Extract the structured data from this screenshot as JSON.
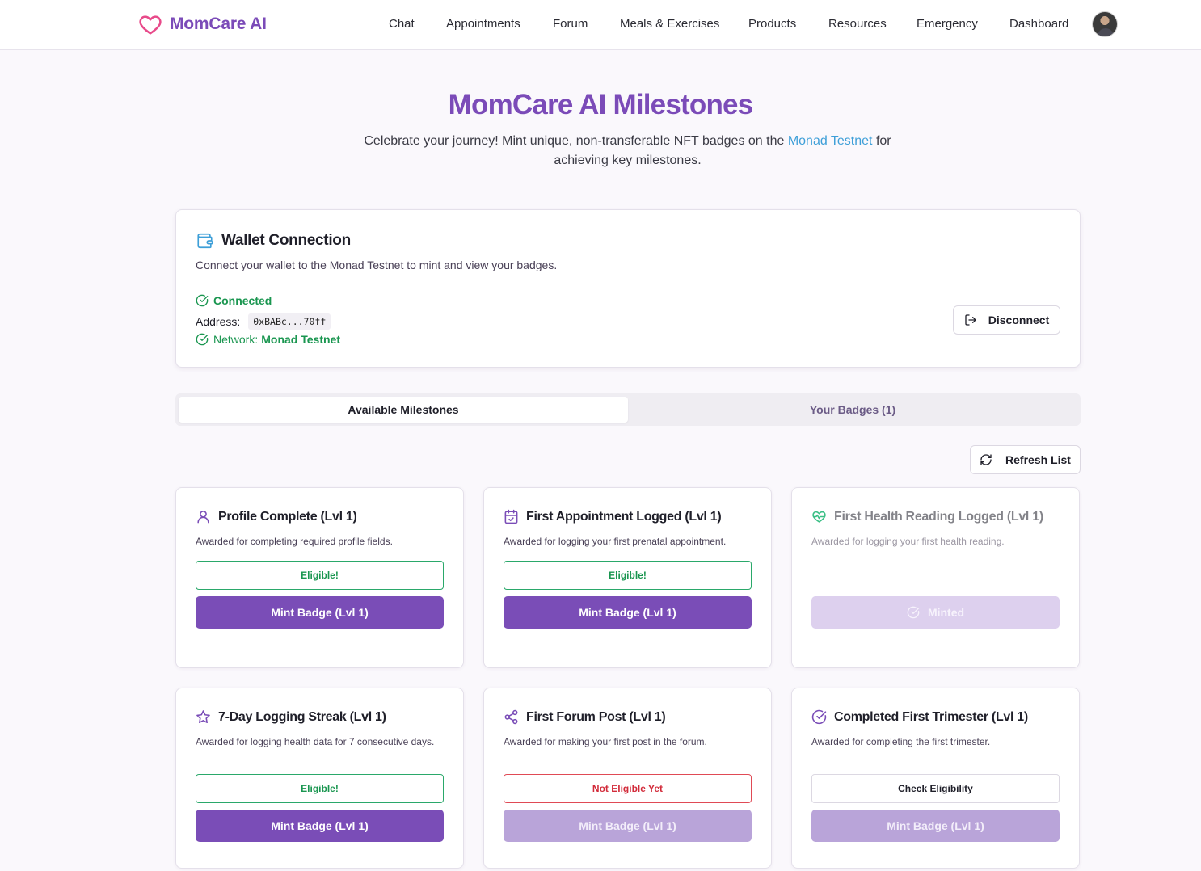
{
  "brand": {
    "name": "MomCare AI",
    "icon": "heart-icon",
    "color": "#7b4bb8",
    "accent": "#e84a8a"
  },
  "nav": {
    "items": [
      {
        "key": "chat",
        "label": "Chat"
      },
      {
        "key": "appointments",
        "label": "Appointments"
      },
      {
        "key": "forum",
        "label": "Forum"
      },
      {
        "key": "meals",
        "label": "Meals & Exercises"
      },
      {
        "key": "products",
        "label": "Products"
      },
      {
        "key": "resources",
        "label": "Resources"
      },
      {
        "key": "emergency",
        "label": "Emergency"
      },
      {
        "key": "dashboard",
        "label": "Dashboard"
      }
    ]
  },
  "hero": {
    "title": "MomCare AI Milestones",
    "subtitle_before": "Celebrate your journey! Mint unique, non-transferable NFT badges on the ",
    "subtitle_link": "Monad Testnet",
    "subtitle_after": " for achieving key milestones."
  },
  "wallet": {
    "icon": "wallet-icon",
    "title": "Wallet Connection",
    "description": "Connect your wallet to the Monad Testnet to mint and view your badges.",
    "status": "Connected",
    "address_label": "Address:",
    "address": "0xBABc...70ff",
    "network_label": "Network:",
    "network": "Monad Testnet",
    "disconnect_label": "Disconnect"
  },
  "tabs": [
    {
      "label": "Available Milestones",
      "active": true
    },
    {
      "label": "Your Badges (1)",
      "active": false
    }
  ],
  "refresh_label": "Refresh List",
  "milestones": [
    {
      "icon": "user-icon",
      "title": "Profile Complete (Lvl 1)",
      "description": "Awarded for completing required profile fields.",
      "status": "Eligible!",
      "status_type": "eligible",
      "action": "Mint Badge (Lvl 1)",
      "action_state": "active"
    },
    {
      "icon": "calendar-check-icon",
      "title": "First Appointment Logged (Lvl 1)",
      "description": "Awarded for logging your first prenatal appointment.",
      "status": "Eligible!",
      "status_type": "eligible",
      "action": "Mint Badge (Lvl 1)",
      "action_state": "active"
    },
    {
      "icon": "heart-pulse-icon",
      "title": "First Health Reading Logged (Lvl 1)",
      "description": "Awarded for logging your first health reading.",
      "status": "",
      "status_type": "none",
      "action": "Minted",
      "action_state": "minted"
    },
    {
      "icon": "star-icon",
      "title": "7-Day Logging Streak (Lvl 1)",
      "description": "Awarded for logging health data for 7 consecutive days.",
      "status": "Eligible!",
      "status_type": "eligible",
      "action": "Mint Badge (Lvl 1)",
      "action_state": "active"
    },
    {
      "icon": "share-icon",
      "title": "First Forum Post (Lvl 1)",
      "description": "Awarded for making your first post in the forum.",
      "status": "Not Eligible Yet",
      "status_type": "noteligible",
      "action": "Mint Badge (Lvl 1)",
      "action_state": "disabled"
    },
    {
      "icon": "check-circle-icon",
      "title": "Completed First Trimester (Lvl 1)",
      "description": "Awarded for completing the first trimester.",
      "status": "Check Eligibility",
      "status_type": "check",
      "action": "Mint Badge (Lvl 1)",
      "action_state": "disabled"
    }
  ],
  "colors": {
    "primary": "#7a4db7",
    "primary_disabled": "#b9a4d9",
    "success": "#1a9650",
    "danger": "#d22b3a",
    "link": "#3e9fd8",
    "background": "#faf8fc"
  }
}
